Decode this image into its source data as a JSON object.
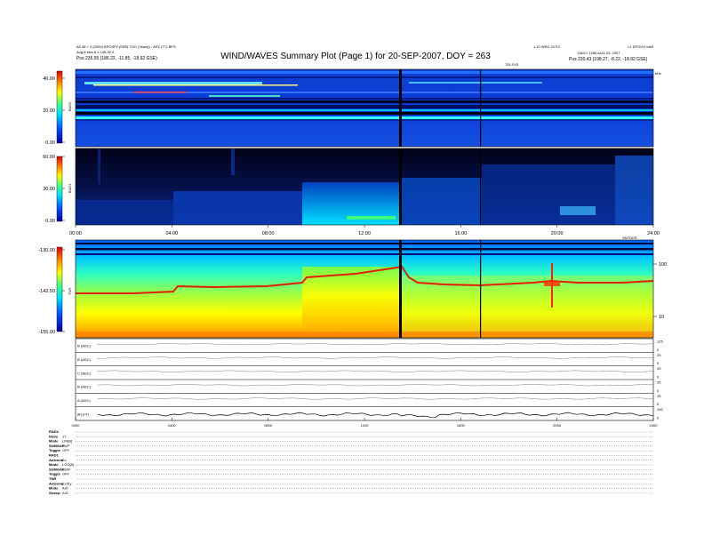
{
  "header": {
    "title": "WIND/WAVES Summary Plot (Page 1) for 20-SEP-2007, DOY = 263",
    "left_line1": "A0.38 + 3 (2000) BPOSPC(SEB) TOO (Yearly) - AR2 (TT) BPS",
    "left_line2": "Ang.8 bins 6 ≥ 136.00 0",
    "left_line3": "Pos  235.55 (186.22, -11.85, -18.92 GSE)",
    "right_line1": "1.10 WED 20 EC",
    "right_line2": "L1 EPOCH m60",
    "right_line3": "DAILY 1450 AUG 23, 2007",
    "right_line4": "Pos  230.43 (198.27, -8.22, -18.92 GSE)",
    "rad2_top_label": "TELSYS",
    "rad2_top_right_unit": "kHz",
    "tnr_top_right": "SNYDER"
  },
  "chart_data": [
    {
      "type": "heatmap",
      "name": "RAD2",
      "ylabel": "RAD2",
      "colorbar_ticks": [
        "40.00",
        "20.00",
        "0.00"
      ]
    },
    {
      "type": "heatmap",
      "name": "RAD1",
      "ylabel": "RAD1",
      "colorbar_ticks": [
        "60.00",
        "30.00",
        "0.00"
      ]
    },
    {
      "type": "heatmap",
      "name": "TNR",
      "ylabel": "TNR",
      "colorbar_ticks": [
        "-130.00",
        "-142.50",
        "-155.00"
      ],
      "right_axis_ticks": [
        "100",
        "10"
      ]
    },
    {
      "type": "line",
      "name": "mag-panels",
      "panel_labels": [
        "B (ADC)",
        "B (ADC)",
        "C (ADC)",
        "B (ADC)",
        "A (ADC)",
        "|B| (nT)"
      ],
      "right_ticks": [
        "125",
        "0",
        "25",
        "0",
        "25",
        "0",
        "25",
        "0",
        "25",
        "0",
        "100",
        "0"
      ]
    }
  ],
  "time_axis": {
    "ticks": [
      "00:00",
      "04:00",
      "08:00",
      "12:00",
      "16:00",
      "20:00",
      "24:00"
    ],
    "bottom_ticks": [
      "0000",
      "0400",
      "0800",
      "1200",
      "1600",
      "2000",
      "2400"
    ]
  },
  "footer": {
    "rows": [
      {
        "k": "RAD2",
        "v": ""
      },
      {
        "k": "Nobs",
        "v": "17"
      },
      {
        "k": "Mode",
        "v": "LIN[B]"
      },
      {
        "k": "SUMGAP",
        "v": "SUP"
      },
      {
        "k": "Toggle",
        "v": "OFF"
      },
      {
        "k": "RAD1",
        "v": ""
      },
      {
        "k": "Antenna",
        "v": "Ex"
      },
      {
        "k": "Mode",
        "v": "LOG[A]"
      },
      {
        "k": "SUMGAP",
        "v": "SUM"
      },
      {
        "k": "Toggle",
        "v": "OFF"
      },
      {
        "k": "TNR",
        "v": ""
      },
      {
        "k": "Antenna",
        "v": "Ex/Ey"
      },
      {
        "k": "Mode",
        "v": "A/D"
      },
      {
        "k": "Sweep",
        "v": "A/D"
      }
    ]
  },
  "colors": {
    "spectrogram_low": "#00008b",
    "spectrogram_mid": "#00c8ff",
    "spectrogram_high": "#ff0000"
  }
}
